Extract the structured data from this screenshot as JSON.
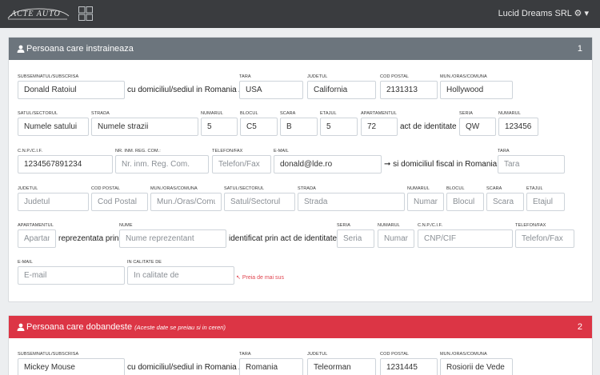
{
  "navbar": {
    "logo_text": "ACTE AUTO",
    "company": "Lucid Dreams SRL",
    "colors": {
      "bg": "#3a3c3f"
    }
  },
  "seller": {
    "title": "Persoana care instraineaza",
    "number": "1",
    "header_color": "#6c757d",
    "labels": {
      "name": "SUBSEMNATUL/SUBSCRISA",
      "country": "TARA",
      "county": "JUDETUL",
      "postal": "COD POSTAL",
      "city": "MUN./ORAS/COMUNA",
      "village": "SATUL/SECTORUL",
      "street": "STRADA",
      "number": "NUMARUL",
      "block": "BLOCUL",
      "entrance": "SCARA",
      "floor": "ETAJUL",
      "apartment": "APARTAMENTUL",
      "series": "SERIA",
      "id_number": "NUMARUL",
      "cnp": "C.N.P./C.I.F.",
      "reg_com": "NR. INM. REG. COM.:",
      "phone": "TELEFON/FAX",
      "email": "E-MAIL",
      "fiscal_country": "TARA",
      "f_county": "JUDETUL",
      "f_postal": "COD POSTAL",
      "f_city": "MUN./ORAS/COMUNA",
      "f_village": "SATUL/SECTORUL",
      "f_street": "STRADA",
      "f_number": "NUMARUL",
      "f_block": "BLOCUL",
      "f_entrance": "SCARA",
      "f_floor": "ETAJUL",
      "f_apartment": "APARTAMENTUL",
      "rep_name": "NUME",
      "rep_series": "SERIA",
      "rep_number": "NUMARUL",
      "rep_cnp": "C.N.P./C.I.F.",
      "rep_phone": "TELEFON/FAX",
      "rep_email": "E-MAIL",
      "rep_quality": "IN CALITATE DE"
    },
    "values": {
      "name": "Donald Ratoiul",
      "country": "USA",
      "county": "California",
      "postal": "2131313",
      "city": "Hollywood",
      "village": "Numele satului",
      "street": "Numele strazii",
      "number": "5",
      "block": "C5",
      "entrance": "B",
      "floor": "5",
      "apartment": "72",
      "series": "QW",
      "id_number": "123456",
      "cnp": "1234567891234",
      "email": "donald@lde.ro"
    },
    "placeholders": {
      "reg_com": "Nr. inm. Reg. Com.",
      "phone": "Telefon/Fax",
      "fiscal_country": "Tara",
      "f_county": "Judetul",
      "f_postal": "Cod Postal",
      "f_city": "Mun./Oras/Comuna",
      "f_village": "Satul/Sectorul",
      "f_street": "Strada",
      "f_number": "Numarul",
      "f_block": "Blocul",
      "f_entrance": "Scara",
      "f_floor": "Etajul",
      "f_apartment": "Apartamentul",
      "rep_name": "Nume reprezentant",
      "rep_series": "Seria",
      "rep_number": "Numarul",
      "rep_cnp": "CNP/CIF",
      "rep_phone": "Telefon/Fax",
      "rep_email": "E-mail",
      "rep_quality": "In calitate de"
    },
    "texts": {
      "domicile": "cu domiciliul/sediul in Romania /",
      "id_doc": "act de identitate",
      "fiscal": "si domiciliul fiscal in Romania /",
      "represented": "reprezentata prin",
      "identified": "identificat prin act de identitate",
      "copy_above": "Preia de mai sus"
    }
  },
  "buyer": {
    "title": "Persoana care dobandeste",
    "subtitle": "(Aceste date se preiau si in cereri)",
    "number": "2",
    "header_color": "#dc3545",
    "labels": {
      "name": "SUBSEMNATUL/SUBSCRISA",
      "country": "TARA",
      "county": "JUDETUL",
      "postal": "COD POSTAL",
      "city": "MUN./ORAS/COMUNA"
    },
    "values": {
      "name": "Mickey Mouse",
      "country": "Romania",
      "county": "Teleorman",
      "postal": "1231445",
      "city": "Rosiorii de Vede"
    },
    "texts": {
      "domicile": "cu domiciliul/sediul in Romania /"
    }
  }
}
